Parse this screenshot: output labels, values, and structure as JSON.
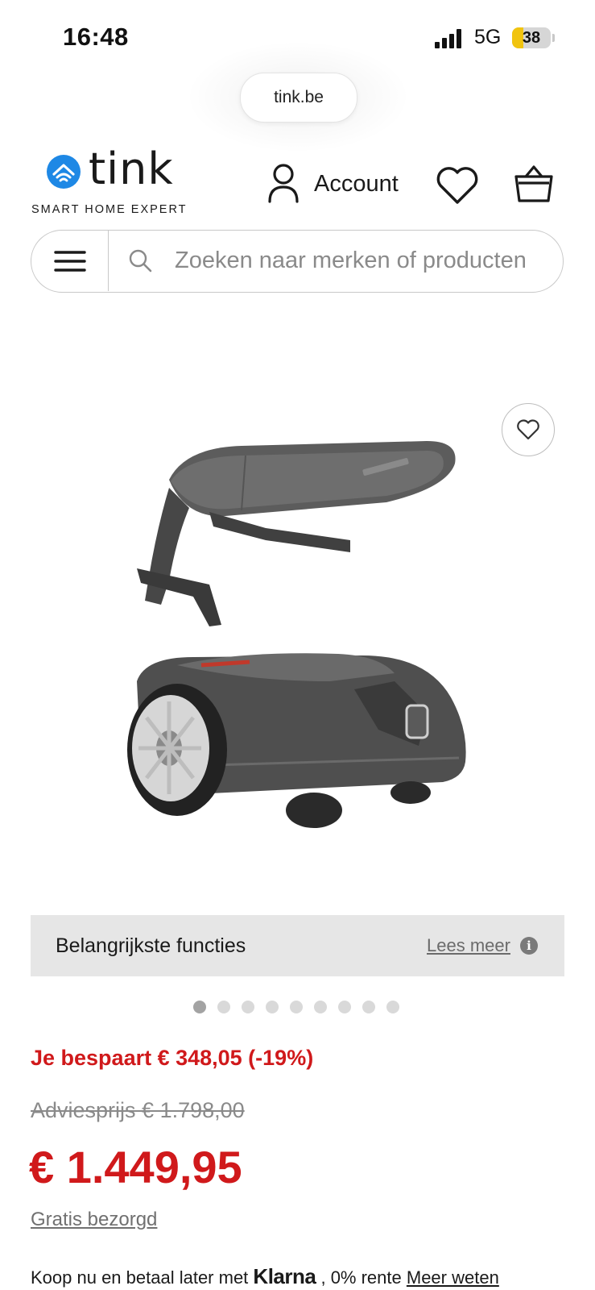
{
  "status_bar": {
    "time": "16:48",
    "network": "5G",
    "battery": "38"
  },
  "browser": {
    "url": "tink.be"
  },
  "header": {
    "logo_text": "tink",
    "tagline": "SMART HOME EXPERT",
    "account_label": "Account"
  },
  "search": {
    "placeholder": "Zoeken naar merken of producten"
  },
  "product": {
    "features_title": "Belangrijkste functies",
    "features_link": "Lees meer",
    "gallery_dots": 9,
    "gallery_active": 1,
    "savings": "Je bespaart € 348,05 (-19%)",
    "advice_price": "Adviesprijs € 1.798,00",
    "price": "€ 1.449,95",
    "delivery": "Gratis bezorgd"
  },
  "klarna": {
    "prefix": "Koop nu en betaal later met",
    "brand": "Klarna",
    "suffix": ", 0% rente",
    "link": "Meer weten"
  },
  "colors": {
    "accent_red": "#d0191b",
    "brand_blue": "#1e88e5",
    "battery_yellow": "#f1c40f"
  },
  "icons": [
    "signal-icon",
    "battery-icon",
    "tink-logo-icon",
    "account-icon",
    "heart-icon",
    "bag-icon",
    "menu-icon",
    "search-icon",
    "info-icon"
  ]
}
